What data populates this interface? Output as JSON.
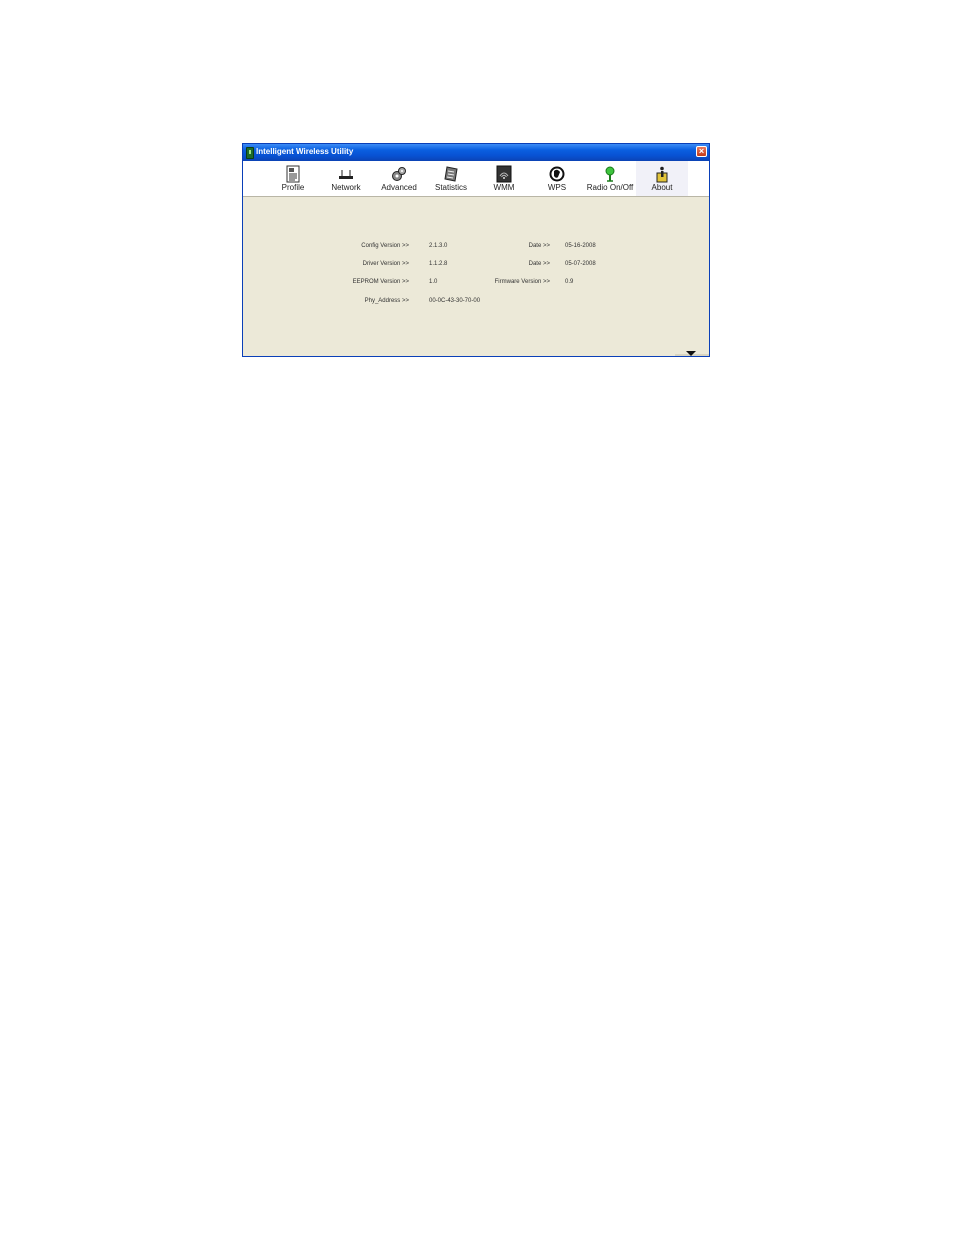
{
  "window": {
    "title": "Intelligent Wireless Utility",
    "close_glyph": "×"
  },
  "toolbar": {
    "items": [
      {
        "label": "Profile",
        "icon": "profile-icon"
      },
      {
        "label": "Network",
        "icon": "network-icon"
      },
      {
        "label": "Advanced",
        "icon": "advanced-icon"
      },
      {
        "label": "Statistics",
        "icon": "statistics-icon"
      },
      {
        "label": "WMM",
        "icon": "wmm-icon"
      },
      {
        "label": "WPS",
        "icon": "wps-icon"
      },
      {
        "label": "Radio On/Off",
        "icon": "radio-icon"
      },
      {
        "label": "About",
        "icon": "about-icon"
      }
    ],
    "active": "About"
  },
  "about": {
    "config_version_label": "Config Version >>",
    "config_version_value": "2.1.3.0",
    "config_date_label": "Date >>",
    "config_date_value": "05-16-2008",
    "driver_version_label": "Driver Version >>",
    "driver_version_value": "1.1.2.8",
    "driver_date_label": "Date >>",
    "driver_date_value": "05-07-2008",
    "eeprom_version_label": "EEPROM Version >>",
    "eeprom_version_value": "1.0",
    "firmware_version_label": "Firmware Version >>",
    "firmware_version_value": "0.9",
    "phy_address_label": "Phy_Address >>",
    "phy_address_value": "00-0C-43-30-70-00"
  },
  "colors": {
    "titlebar": "#0a5fe0",
    "panel": "#ece9d8",
    "toolbar": "#ffffff"
  }
}
